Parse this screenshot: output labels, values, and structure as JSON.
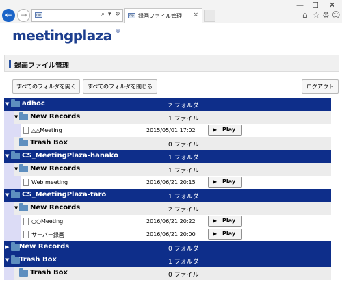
{
  "browser": {
    "tab_title": "録画ファイル管理",
    "favicon_text": "mp",
    "addr_search_glyph": "⌕",
    "addr_dropdown_glyph": "▾",
    "addr_refresh_glyph": "↻",
    "back_glyph": "←",
    "forward_glyph": "→",
    "tab_close_glyph": "×",
    "win_min": "—",
    "win_max": "☐",
    "win_close": "✕",
    "home_glyph": "⌂",
    "star_glyph": "☆",
    "gear_glyph": "⚙",
    "smile_glyph": "☺"
  },
  "logo": {
    "text": "meetingplaza",
    "reg": "®"
  },
  "page_title": "録画ファイル管理",
  "buttons": {
    "open_all": "すべてのフォルダを開く",
    "close_all": "すべてのフォルダを閉じる",
    "logout": "ログアウト"
  },
  "tree": {
    "adhoc": {
      "name": "adhoc",
      "count": "2 フォルダ"
    },
    "adhoc_new": {
      "name": "New Records",
      "count": "1 ファイル"
    },
    "adhoc_file1": {
      "name": "△△Meeting",
      "date": "2015/05/01 17:02",
      "play": "Play"
    },
    "adhoc_trash": {
      "name": "Trash Box",
      "count": "0 ファイル"
    },
    "hanako": {
      "name": "CS_MeetingPlaza-hanako",
      "count": "1 フォルダ"
    },
    "hanako_new": {
      "name": "New Records",
      "count": "1 ファイル"
    },
    "hanako_file1": {
      "name": "Web meeting",
      "date": "2016/06/21 20:15",
      "play": "Play"
    },
    "taro": {
      "name": "CS_MeetingPlaza-taro",
      "count": "1 フォルダ"
    },
    "taro_new": {
      "name": "New Records",
      "count": "2 ファイル"
    },
    "taro_file1": {
      "name": "○○Meeting",
      "date": "2016/06/21 20:22",
      "play": "Play"
    },
    "taro_file2": {
      "name": "サーバー録画",
      "date": "2016/06/21 20:00",
      "play": "Play"
    },
    "root_new": {
      "name": "New Records",
      "count": "0 フォルダ"
    },
    "root_trash": {
      "name": "Trash Box",
      "count": "1 フォルダ"
    },
    "root_trash_box": {
      "name": "Trash Box",
      "count": "0 ファイル"
    }
  },
  "colors": {
    "header_row": "#0e2e8a",
    "sub_row": "#ececec",
    "indent": "#dcdcf6",
    "folder_icon": "#5e8fbf"
  }
}
